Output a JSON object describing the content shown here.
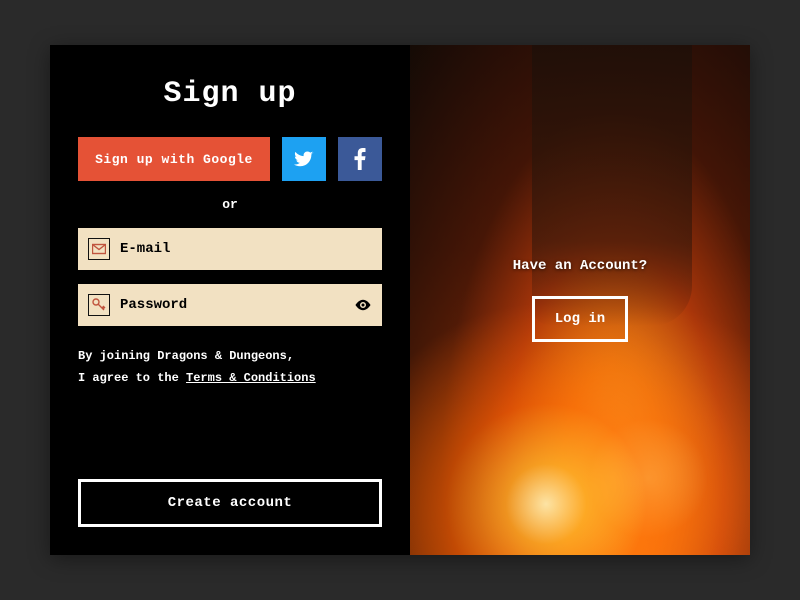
{
  "signup": {
    "title": "Sign up",
    "google_label": "Sign up with Google",
    "or_label": "or",
    "email_placeholder": "E-mail",
    "password_placeholder": "Password",
    "terms_line1": "By joining Dragons & Dungeons,",
    "terms_line2_prefix": "I agree to the ",
    "terms_link": "Terms & Conditions",
    "create_label": "Create account"
  },
  "login_panel": {
    "prompt": "Have an Account?",
    "login_label": "Log in"
  },
  "colors": {
    "google": "#e55236",
    "twitter": "#1da1f2",
    "facebook": "#3b5998"
  }
}
